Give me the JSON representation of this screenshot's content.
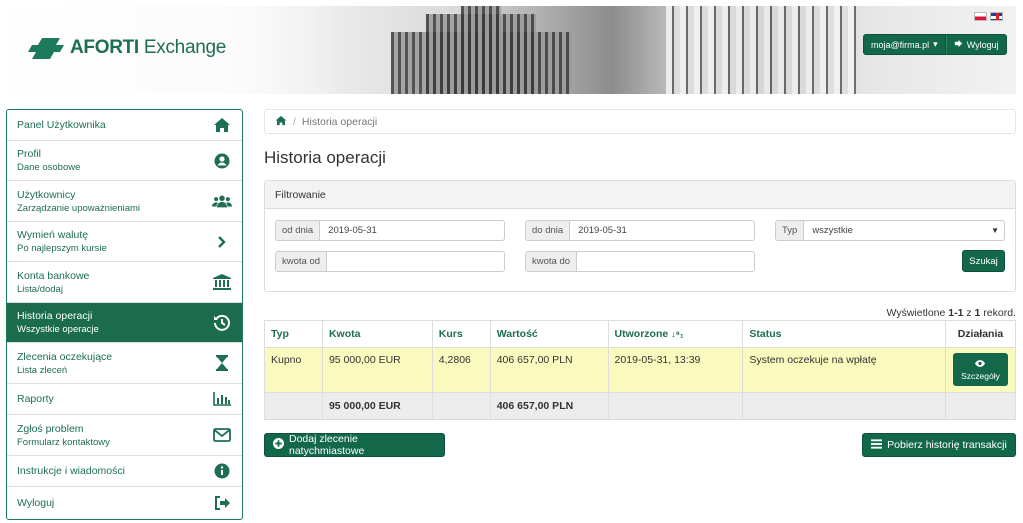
{
  "header": {
    "brand_bold": "AFORTI",
    "brand_rest": "Exchange",
    "user_email": "moja@firma.pl",
    "logout": "Wyloguj"
  },
  "sidebar": {
    "items": [
      {
        "title": "Panel Użytkownika",
        "subtitle": "",
        "icon": "home-icon"
      },
      {
        "title": "Profil",
        "subtitle": "Dane osobowe",
        "icon": "user-circle-icon"
      },
      {
        "title": "Użytkownicy",
        "subtitle": "Zarządzanie upoważnieniami",
        "icon": "users-icon"
      },
      {
        "title": "Wymień walutę",
        "subtitle": "Po najlepszym kursie",
        "icon": "chevron-right-icon"
      },
      {
        "title": "Konta bankowe",
        "subtitle": "Lista/dodaj",
        "icon": "bank-icon"
      },
      {
        "title": "Historia operacji",
        "subtitle": "Wszystkie operacje",
        "icon": "history-icon"
      },
      {
        "title": "Zlecenia oczekujące",
        "subtitle": "Lista zleceń",
        "icon": "hourglass-icon"
      },
      {
        "title": "Raporty",
        "subtitle": "",
        "icon": "bar-chart-icon"
      },
      {
        "title": "Zgłoś problem",
        "subtitle": "Formularz kontaktowy",
        "icon": "envelope-icon"
      },
      {
        "title": "Instrukcje i wiadomości",
        "subtitle": "",
        "icon": "info-icon"
      },
      {
        "title": "Wyloguj",
        "subtitle": "",
        "icon": "sign-out-icon"
      }
    ],
    "active_index": 5
  },
  "breadcrumb": {
    "current": "Historia operacji"
  },
  "page_title": "Historia operacji",
  "filter": {
    "heading": "Filtrowanie",
    "date_from_label": "od dnia",
    "date_from": "2019-05-31",
    "date_to_label": "do dnia",
    "date_to": "2019-05-31",
    "type_label": "Typ",
    "type_value": "wszystkie",
    "amount_from_label": "kwota od",
    "amount_from": "",
    "amount_to_label": "kwota do",
    "amount_to": "",
    "search_button": "Szukaj"
  },
  "records": {
    "prefix": "Wyświetlone",
    "range": "1-1",
    "of": "z",
    "total": "1",
    "suffix": "rekord."
  },
  "table": {
    "headers": [
      "Typ",
      "Kwota",
      "Kurs",
      "Wartość",
      "Utworzone",
      "Status",
      "Działania"
    ],
    "rows": [
      {
        "typ": "Kupno",
        "kwota": "95 000,00 EUR",
        "kurs": "4,2806",
        "wartosc": "406 657,00 PLN",
        "utworzone": "2019-05-31, 13:39",
        "status": "System oczekuje na wpłatę",
        "action": "Szczegóły"
      }
    ],
    "summary": {
      "kwota": "95 000,00 EUR",
      "wartosc": "406 657,00 PLN"
    }
  },
  "buttons": {
    "add_order": "Dodaj zlecenie natychmiastowe",
    "download_history": "Pobierz historię transakcji"
  },
  "colors": {
    "accent": "#1a6c4c",
    "row_highlight": "#fafabf"
  }
}
